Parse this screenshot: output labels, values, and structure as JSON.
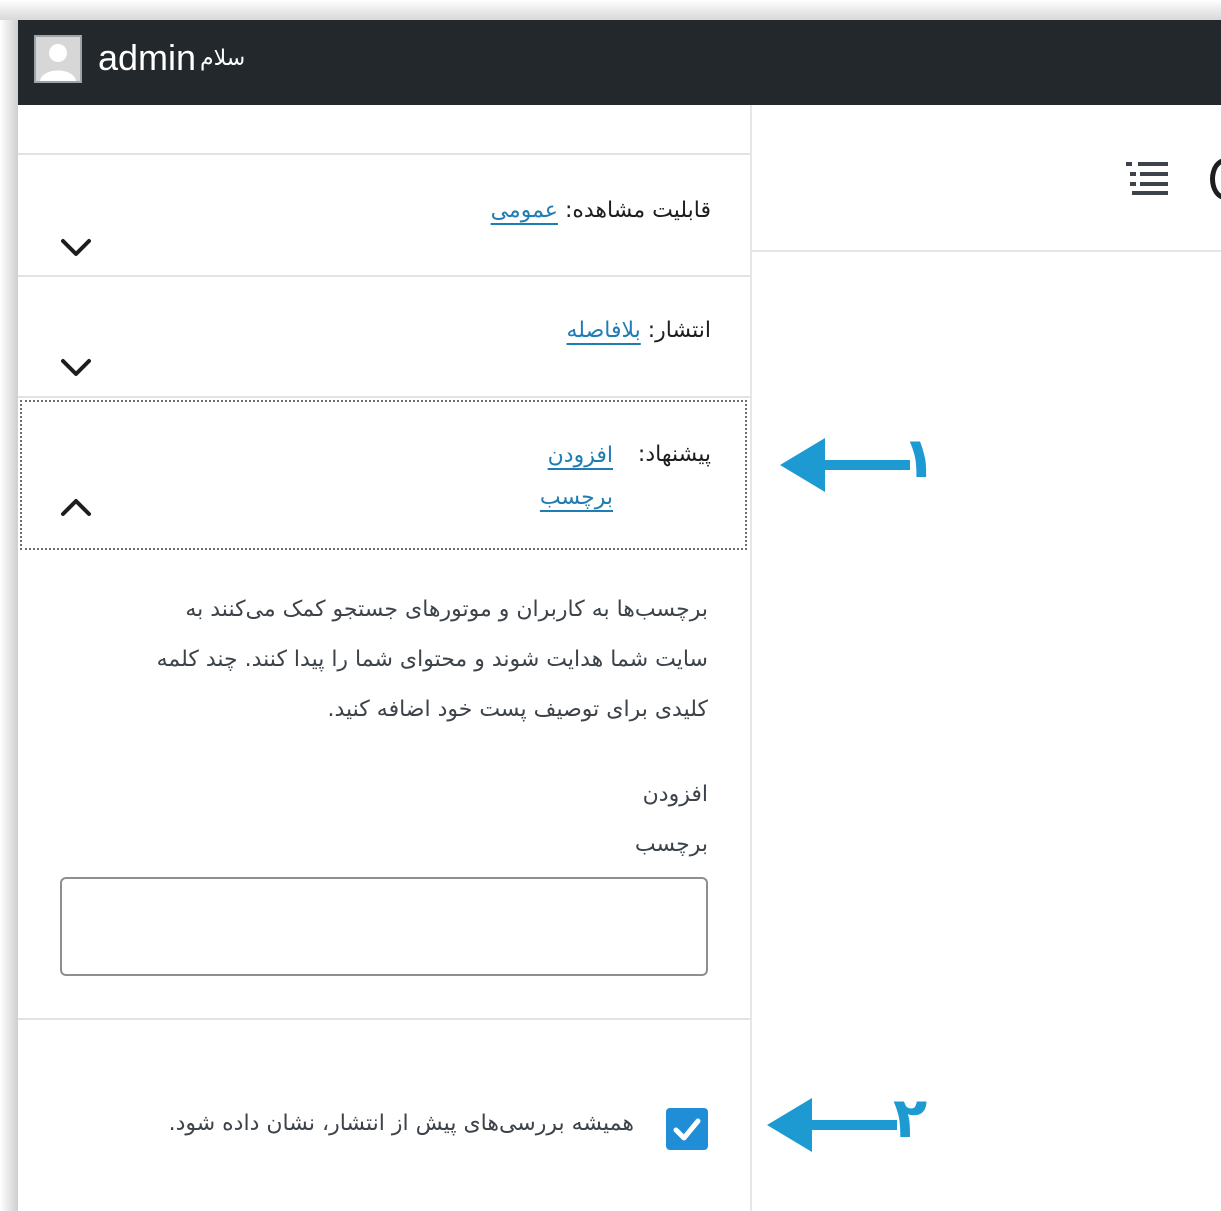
{
  "admin_bar": {
    "greeting": "سلام",
    "user_name": "admin"
  },
  "sidebar": {
    "visibility": {
      "label": "قابلیت مشاهده:",
      "value": "عمومی"
    },
    "publish": {
      "label": "انتشار:",
      "value": "بلافاصله"
    },
    "suggestion": {
      "label": "پیشنهاد:",
      "link_line1": "افزودن",
      "link_line2": "برچسب"
    },
    "tags_help": {
      "line1": "برچسب‌ها به کاربران و موتورهای جستجو کمک می‌کنند به",
      "line2": "سایت شما هدایت شوند و محتوای شما را پیدا کنند. چند کلمه",
      "line3": "کلیدی برای توصیف پست خود اضافه کنید."
    },
    "add_tag_label": {
      "line1": "افزودن",
      "line2": "برچسب"
    },
    "tag_input": {
      "value": ""
    },
    "prepublish_checkbox": {
      "label": "همیشه بررسی‌های پیش از انتشار، نشان داده شود.",
      "checked": true
    }
  },
  "annotations": [
    {
      "number": "۱",
      "color": "#1e9ad3"
    },
    {
      "number": "۲",
      "color": "#1e9ad3"
    }
  ],
  "icons": {
    "avatar": "default-user-avatar",
    "chevron_down": "chevron-down-icon",
    "chevron_up": "chevron-up-icon",
    "checkmark": "checkmark-icon",
    "list_view": "list-view-icon"
  },
  "colors": {
    "admin_bar": "#23282d",
    "link": "#1f7db3",
    "checkbox": "#1f8ed6",
    "arrow": "#1e9ad3"
  }
}
